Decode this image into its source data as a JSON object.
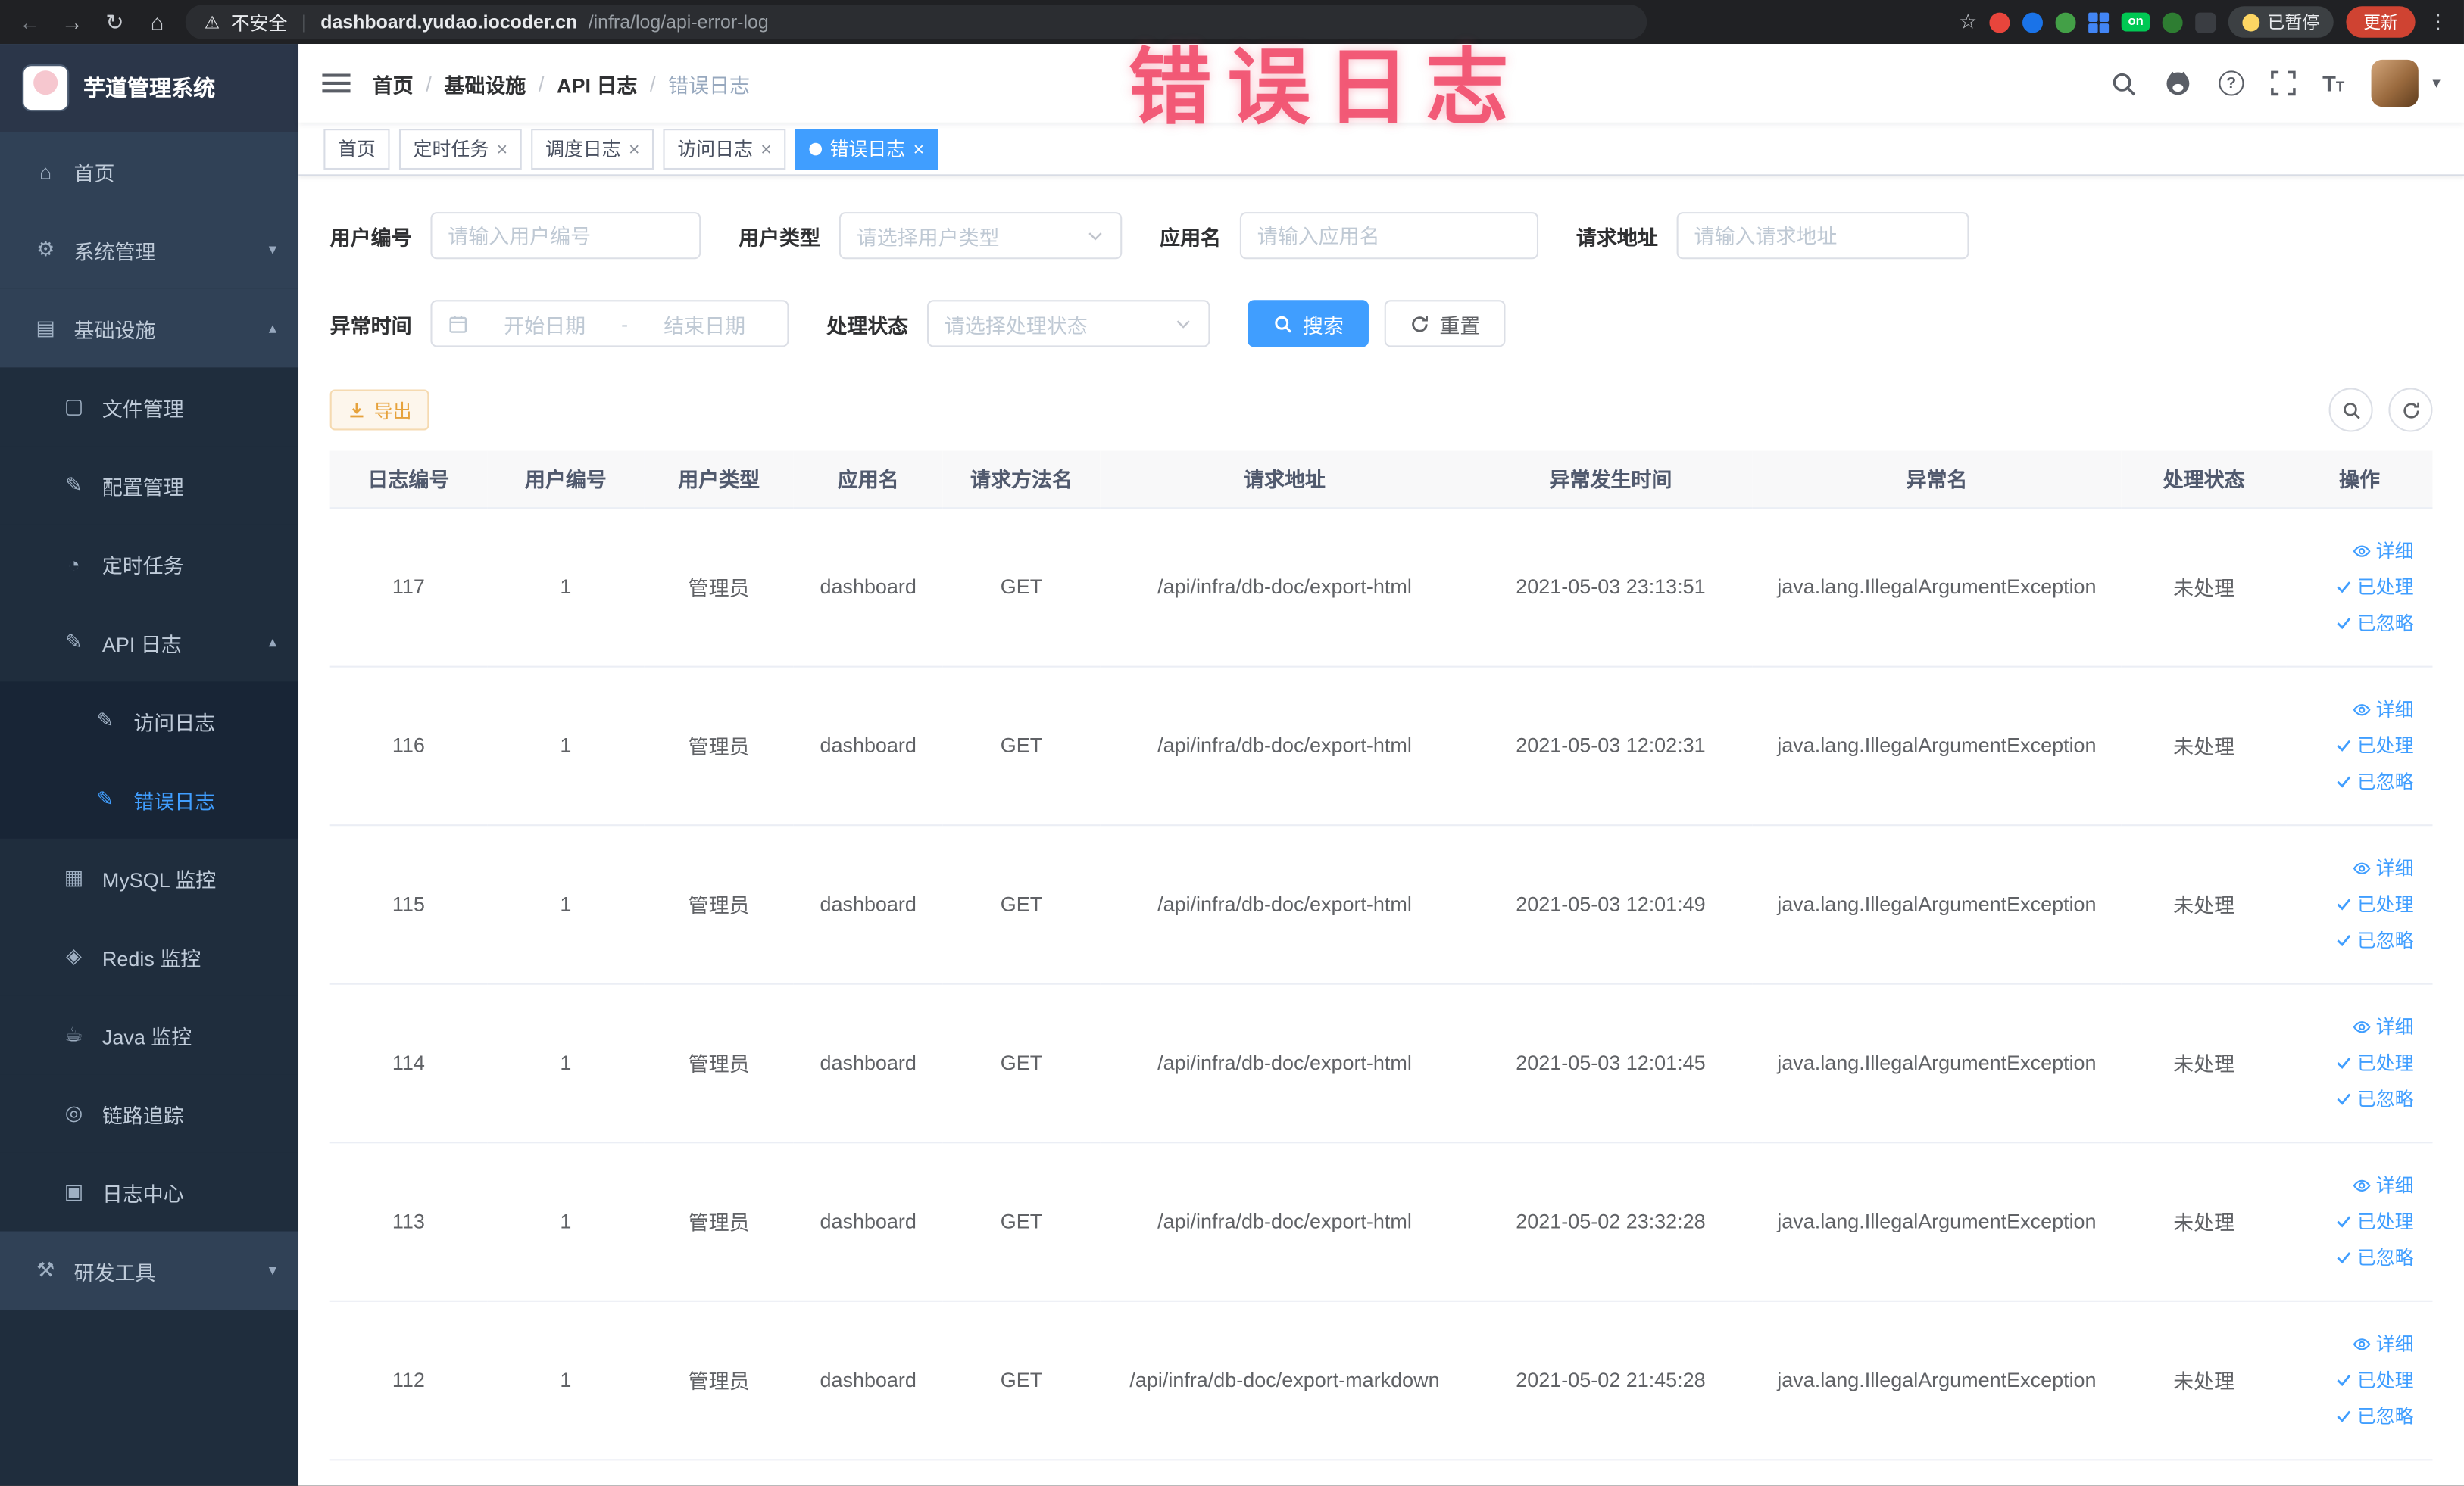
{
  "browser": {
    "security_label": "不安全",
    "url_domain": "dashboard.yudao.iocoder.cn",
    "url_path": "/infra/log/api-error-log",
    "paused_badge": "已暂停",
    "update_label": "更新",
    "on_badge": "on"
  },
  "overlay_annotation": "错误日志",
  "icons": {
    "back": "←",
    "forward": "→",
    "reload": "↻",
    "home_btn": "⌂",
    "warning": "⚠",
    "star": "☆",
    "menu_dots": "⋮",
    "caret_down": "▾",
    "caret_up": "▴",
    "question": "?",
    "font_large": "T",
    "font_small": "T",
    "url_separator": "|",
    "avatar_caret": "▾",
    "sidebar": {
      "home": "⌂",
      "system": "⚙",
      "infra": "▤",
      "file": "▢",
      "config": "✎",
      "job": "◔",
      "api": "✎",
      "access": "✎",
      "error": "✎",
      "mysql": "▦",
      "redis": "◈",
      "java": "☕",
      "trace": "◎",
      "log_center": "▣",
      "dev": "⚒"
    }
  },
  "sidebar": {
    "logo_title": "芋道管理系统",
    "items": {
      "home": "首页",
      "system": "系统管理",
      "infra": "基础设施",
      "file": "文件管理",
      "config": "配置管理",
      "job": "定时任务",
      "api_log": "API 日志",
      "access_log": "访问日志",
      "error_log": "错误日志",
      "mysql": "MySQL 监控",
      "redis": "Redis 监控",
      "java": "Java 监控",
      "trace": "链路追踪",
      "log_center": "日志中心",
      "dev_tools": "研发工具"
    }
  },
  "navbar": {
    "breadcrumb": [
      "首页",
      "基础设施",
      "API 日志",
      "错误日志"
    ]
  },
  "tabs": [
    "首页",
    "定时任务",
    "调度日志",
    "访问日志",
    "错误日志"
  ],
  "filters": {
    "user_id_label": "用户编号",
    "user_id_placeholder": "请输入用户编号",
    "user_type_label": "用户类型",
    "user_type_placeholder": "请选择用户类型",
    "app_name_label": "应用名",
    "app_name_placeholder": "请输入应用名",
    "request_url_label": "请求地址",
    "request_url_placeholder": "请输入请求地址",
    "exception_time_label": "异常时间",
    "date_start_placeholder": "开始日期",
    "date_separator": "-",
    "date_end_placeholder": "结束日期",
    "process_status_label": "处理状态",
    "process_status_placeholder": "请选择处理状态",
    "search_label": "搜索",
    "reset_label": "重置"
  },
  "toolbar": {
    "export_label": "导出"
  },
  "table": {
    "columns": [
      "日志编号",
      "用户编号",
      "用户类型",
      "应用名",
      "请求方法名",
      "请求地址",
      "异常发生时间",
      "异常名",
      "处理状态",
      "操作"
    ],
    "row_actions": [
      "详细",
      "已处理",
      "已忽略"
    ],
    "rows": [
      {
        "id": "117",
        "user_id": "1",
        "user_type": "管理员",
        "app": "dashboard",
        "method": "GET",
        "url": "/api/infra/db-doc/export-html",
        "time": "2021-05-03 23:13:51",
        "exception": "java.lang.IllegalArgumentException",
        "status": "未处理"
      },
      {
        "id": "116",
        "user_id": "1",
        "user_type": "管理员",
        "app": "dashboard",
        "method": "GET",
        "url": "/api/infra/db-doc/export-html",
        "time": "2021-05-03 12:02:31",
        "exception": "java.lang.IllegalArgumentException",
        "status": "未处理"
      },
      {
        "id": "115",
        "user_id": "1",
        "user_type": "管理员",
        "app": "dashboard",
        "method": "GET",
        "url": "/api/infra/db-doc/export-html",
        "time": "2021-05-03 12:01:49",
        "exception": "java.lang.IllegalArgumentException",
        "status": "未处理"
      },
      {
        "id": "114",
        "user_id": "1",
        "user_type": "管理员",
        "app": "dashboard",
        "method": "GET",
        "url": "/api/infra/db-doc/export-html",
        "time": "2021-05-03 12:01:45",
        "exception": "java.lang.IllegalArgumentException",
        "status": "未处理"
      },
      {
        "id": "113",
        "user_id": "1",
        "user_type": "管理员",
        "app": "dashboard",
        "method": "GET",
        "url": "/api/infra/db-doc/export-html",
        "time": "2021-05-02 23:32:28",
        "exception": "java.lang.IllegalArgumentException",
        "status": "未处理"
      },
      {
        "id": "112",
        "user_id": "1",
        "user_type": "管理员",
        "app": "dashboard",
        "method": "GET",
        "url": "/api/infra/db-doc/export-markdown",
        "time": "2021-05-02 21:45:28",
        "exception": "java.lang.IllegalArgumentException",
        "status": "未处理"
      }
    ]
  },
  "colors": {
    "accent": "#409eff",
    "sidebar_bg": "#304156",
    "sidebar_sub_bg": "#1f2d3d",
    "warning": "#e6a23c",
    "annotation": "#f04868"
  }
}
